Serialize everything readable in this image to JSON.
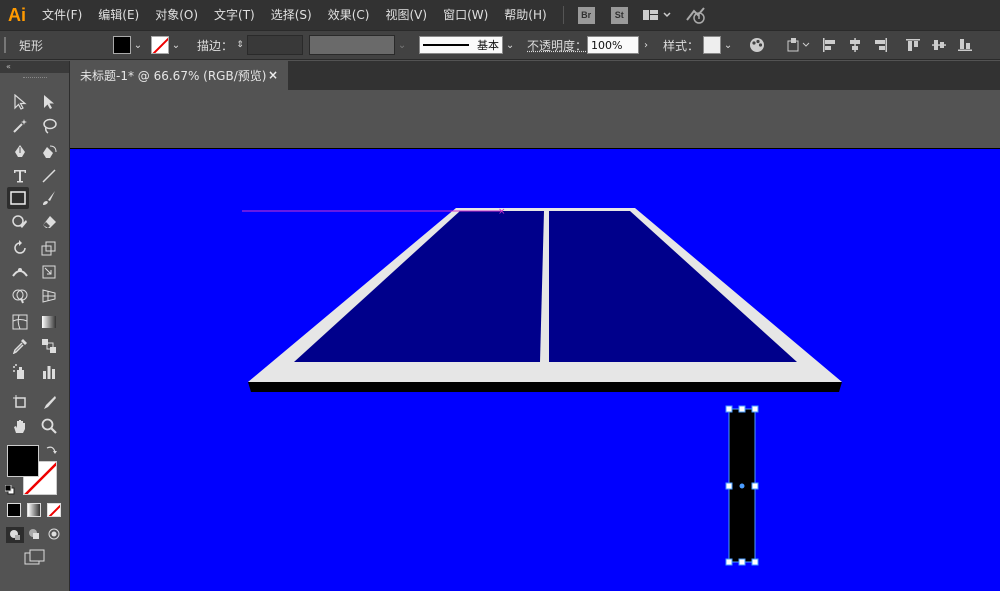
{
  "app": {
    "logo": "Ai"
  },
  "menu": [
    "文件(F)",
    "编辑(E)",
    "对象(O)",
    "文字(T)",
    "选择(S)",
    "效果(C)",
    "视图(V)",
    "窗口(W)",
    "帮助(H)"
  ],
  "menubar_badges": {
    "bridge": "Br",
    "stock": "St"
  },
  "controlbar": {
    "object_type": "矩形",
    "stroke_label": "描边：",
    "stroke_style": "基本",
    "opacity_label": "不透明度：",
    "opacity_value": "100%",
    "style_label": "样式："
  },
  "document": {
    "tab_title": "未标题-1* @ 66.67% (RGB/预览)",
    "tab_close": "×"
  },
  "colors": {
    "artboard_bg": "#0000ff",
    "table_top": "#00008b",
    "table_border": "#e6e6e6",
    "table_edge": "#000000",
    "net_post": "#000000",
    "guide": "#cc33cc",
    "selection": "#4a9cff",
    "fill": "#000000"
  },
  "icons": {
    "selection": "arrow-icon",
    "direct_selection": "white-arrow-icon",
    "rectangle": "rectangle-icon"
  }
}
